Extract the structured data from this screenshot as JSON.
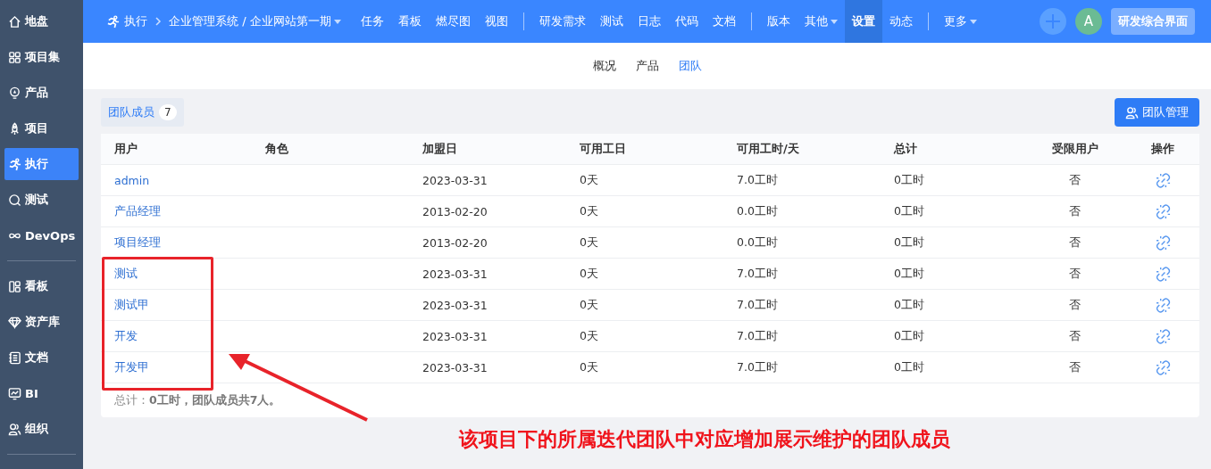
{
  "sidebar": {
    "groups": [
      [
        {
          "label": "地盘",
          "selected": false
        },
        {
          "label": "项目集",
          "selected": false
        },
        {
          "label": "产品",
          "selected": false
        },
        {
          "label": "项目",
          "selected": false
        },
        {
          "label": "执行",
          "selected": true
        },
        {
          "label": "测试",
          "selected": false
        },
        {
          "label": "DevOps",
          "selected": false
        }
      ],
      [
        {
          "label": "看板",
          "selected": false
        },
        {
          "label": "资产库",
          "selected": false
        },
        {
          "label": "文档",
          "selected": false
        },
        {
          "label": "BI",
          "selected": false
        },
        {
          "label": "组织",
          "selected": false
        }
      ]
    ]
  },
  "topbar": {
    "module": "执行",
    "project": "企业管理系统 / 企业网站第一期",
    "nav_groups": [
      [
        {
          "label": "任务",
          "selected": false,
          "dropdown": false
        },
        {
          "label": "看板",
          "selected": false,
          "dropdown": false
        },
        {
          "label": "燃尽图",
          "selected": false,
          "dropdown": false
        },
        {
          "label": "视图",
          "selected": false,
          "dropdown": false
        }
      ],
      [
        {
          "label": "研发需求",
          "selected": false,
          "dropdown": false
        },
        {
          "label": "测试",
          "selected": false,
          "dropdown": false
        },
        {
          "label": "日志",
          "selected": false,
          "dropdown": false
        },
        {
          "label": "代码",
          "selected": false,
          "dropdown": false
        },
        {
          "label": "文档",
          "selected": false,
          "dropdown": false
        }
      ],
      [
        {
          "label": "版本",
          "selected": false,
          "dropdown": false
        },
        {
          "label": "其他",
          "selected": false,
          "dropdown": true
        },
        {
          "label": "设置",
          "selected": true,
          "dropdown": false
        },
        {
          "label": "动态",
          "selected": false,
          "dropdown": false
        }
      ],
      [
        {
          "label": "更多",
          "selected": false,
          "dropdown": true
        }
      ]
    ],
    "avatar": "A",
    "workspace_button": "研发综合界面"
  },
  "subnav": [
    {
      "label": "概况",
      "selected": false
    },
    {
      "label": "产品",
      "selected": false
    },
    {
      "label": "团队",
      "selected": true
    }
  ],
  "toolbar": {
    "tab": "团队成员",
    "count": "7",
    "manage_button": "团队管理"
  },
  "table": {
    "columns": [
      "用户",
      "角色",
      "加盟日",
      "可用工日",
      "可用工时/天",
      "总计",
      "受限用户",
      "操作"
    ],
    "rows": [
      {
        "user": "admin",
        "joined": "2023-03-31",
        "days": "0天",
        "hours": "7.0工时",
        "total": "0工时",
        "limited": "否"
      },
      {
        "user": "产品经理",
        "joined": "2013-02-20",
        "days": "0天",
        "hours": "0.0工时",
        "total": "0工时",
        "limited": "否"
      },
      {
        "user": "项目经理",
        "joined": "2013-02-20",
        "days": "0天",
        "hours": "0.0工时",
        "total": "0工时",
        "limited": "否"
      },
      {
        "user": "测试",
        "joined": "2023-03-31",
        "days": "0天",
        "hours": "7.0工时",
        "total": "0工时",
        "limited": "否"
      },
      {
        "user": "测试甲",
        "joined": "2023-03-31",
        "days": "0天",
        "hours": "7.0工时",
        "total": "0工时",
        "limited": "否"
      },
      {
        "user": "开发",
        "joined": "2023-03-31",
        "days": "0天",
        "hours": "7.0工时",
        "total": "0工时",
        "limited": "否"
      },
      {
        "user": "开发甲",
        "joined": "2023-03-31",
        "days": "0天",
        "hours": "7.0工时",
        "total": "0工时",
        "limited": "否"
      }
    ],
    "summary": "总计：**0工时，团队成员共7人。**"
  },
  "annotation": {
    "caption": "该项目下的所属迭代团队中对应增加展示维护的团队成员"
  }
}
